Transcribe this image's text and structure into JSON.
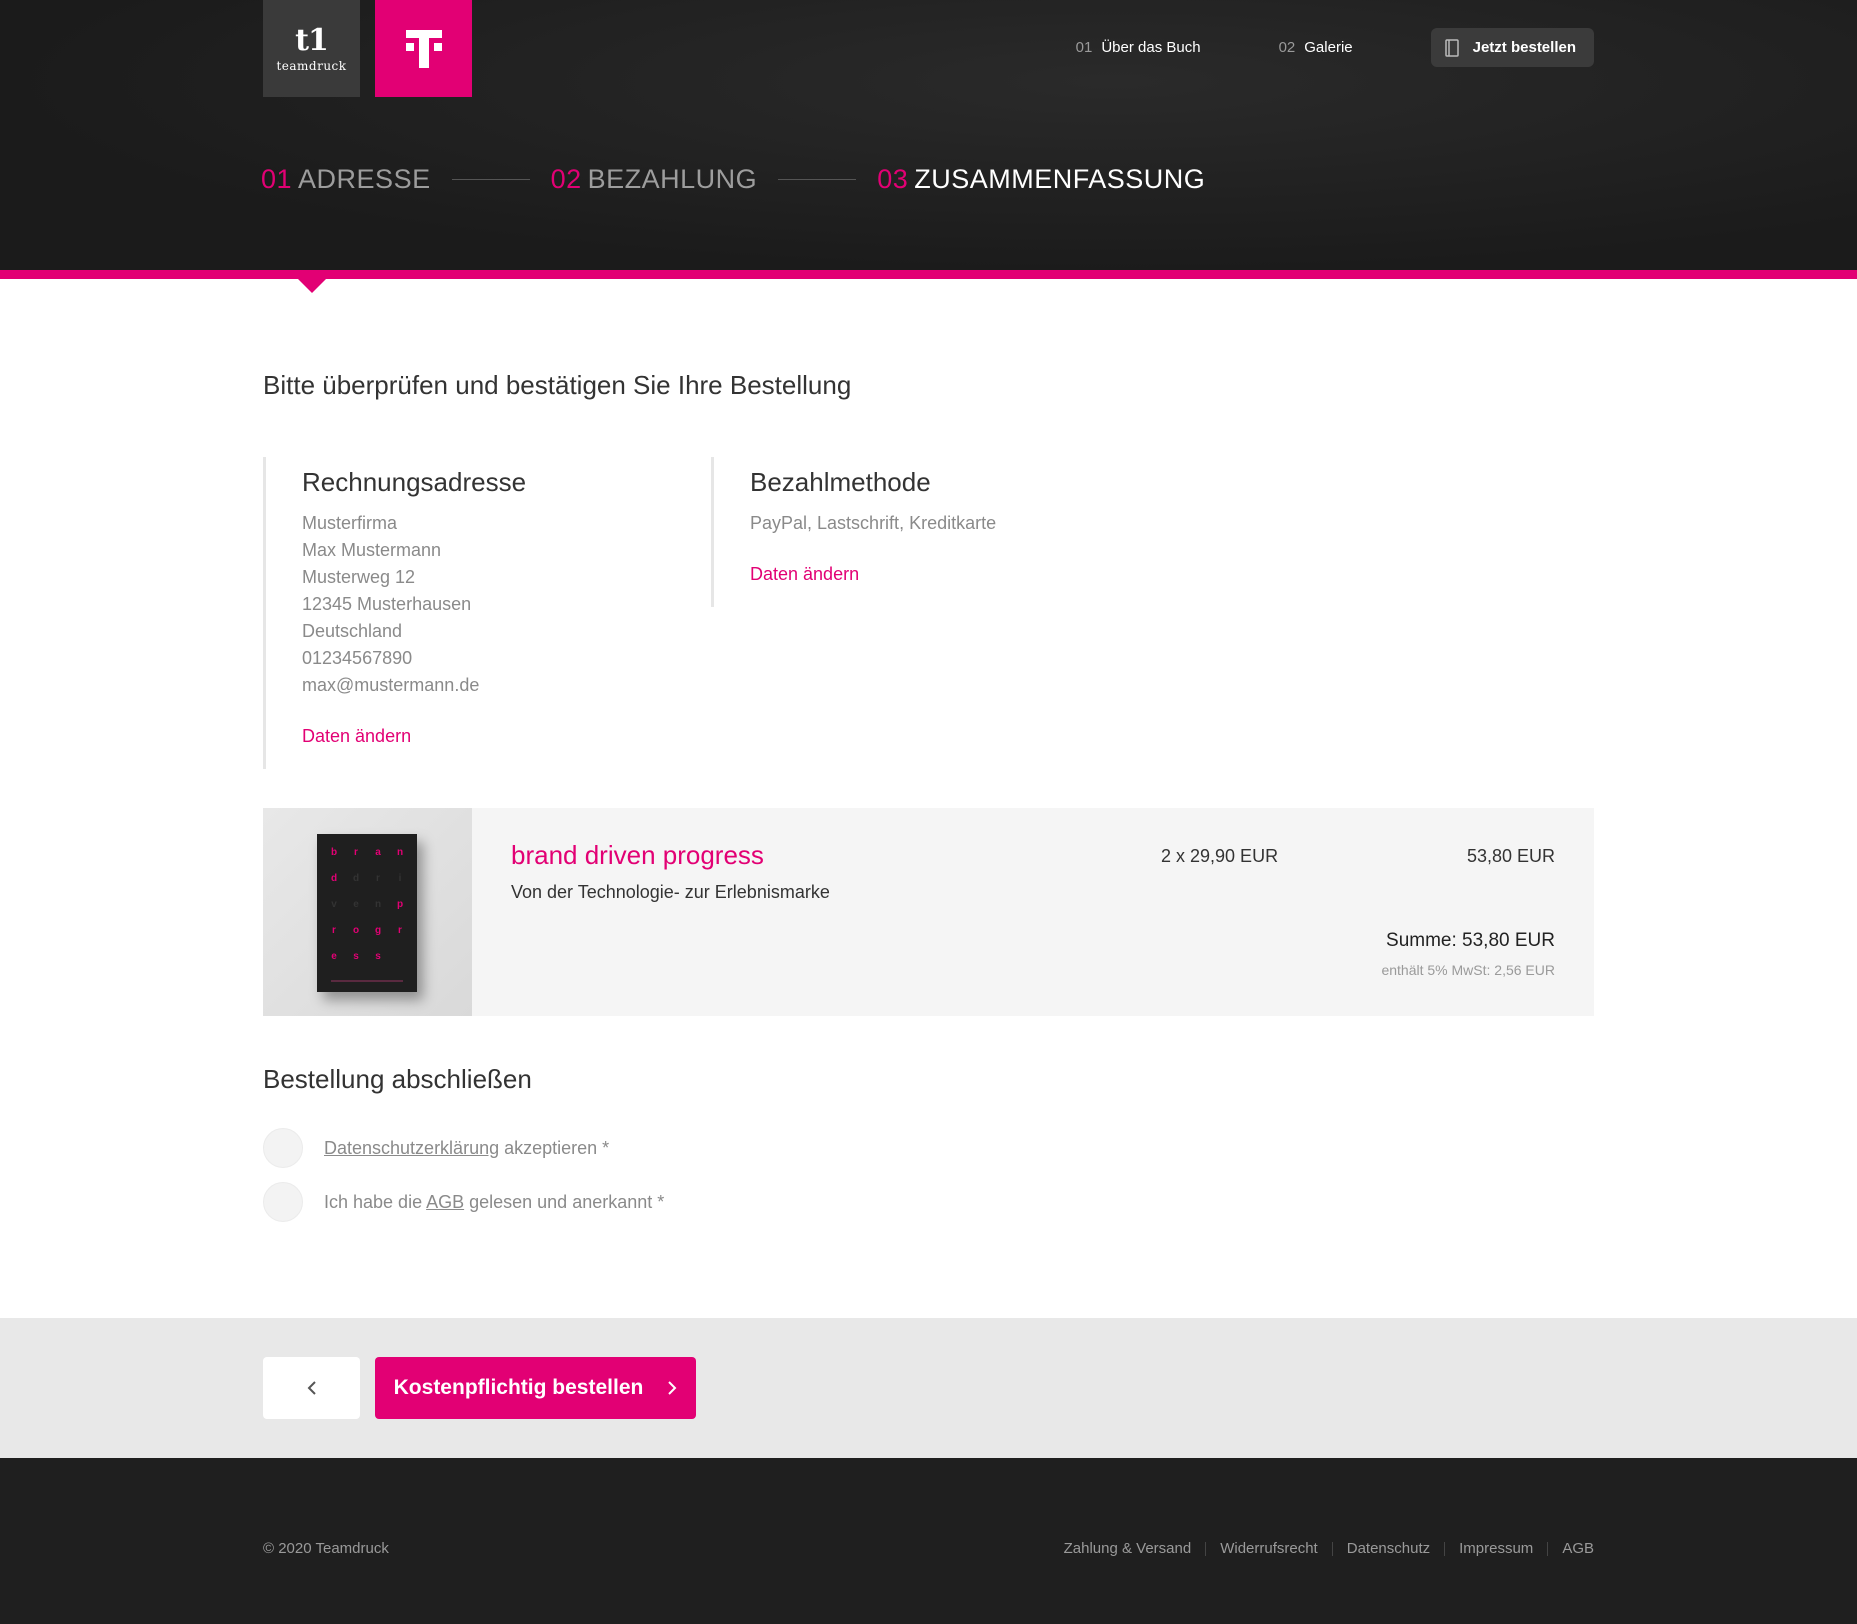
{
  "brand": {
    "teamdruck_mark": "t1",
    "teamdruck_word": "teamdruck",
    "accent_color": "#e20074"
  },
  "nav": {
    "items": [
      {
        "num": "01",
        "label": "Über das Buch"
      },
      {
        "num": "02",
        "label": "Galerie"
      }
    ],
    "order_button": "Jetzt bestellen"
  },
  "steps": [
    {
      "num": "01",
      "label": "ADRESSE"
    },
    {
      "num": "02",
      "label": "BEZAHLUNG"
    },
    {
      "num": "03",
      "label": "ZUSAMMENFASSUNG"
    }
  ],
  "main": {
    "title": "Bitte überprüfen und bestätigen Sie Ihre Bestellung",
    "billing": {
      "heading": "Rechnungsadresse",
      "lines": [
        "Musterfirma",
        "Max Mustermann",
        "Musterweg 12",
        "12345 Musterhausen",
        "Deutschland",
        "01234567890",
        "max@mustermann.de"
      ],
      "edit": "Daten ändern"
    },
    "payment": {
      "heading": "Bezahlmethode",
      "methods": "PayPal, Lastschrift, Kreditkarte",
      "edit": "Daten ändern"
    },
    "product": {
      "title": "brand driven progress",
      "subtitle": "Von der Technologie- zur Erlebnismarke",
      "quantity_price": "2 x 29,90 EUR",
      "line_total": "53,80 EUR",
      "sum": "Summe: 53,80 EUR",
      "vat": "enthält 5% MwSt: 2,56 EUR",
      "cover_letters": [
        "b",
        "r",
        "a",
        "n",
        "d",
        "d",
        "r",
        "i",
        "v",
        "e",
        "n",
        "p",
        "r",
        "o",
        "g",
        "r",
        "e",
        "s",
        "s",
        ""
      ]
    },
    "complete": {
      "heading": "Bestellung abschließen",
      "privacy_link": "Datenschutzerklärung",
      "privacy_suffix": " akzeptieren *",
      "terms_prefix": "Ich habe die ",
      "terms_link": "AGB",
      "terms_suffix": " gelesen und anerkannt *"
    }
  },
  "actions": {
    "submit": "Kostenpflichtig bestellen"
  },
  "footer": {
    "copyright": "© 2020 Teamdruck",
    "links": [
      "Zahlung & Versand",
      "Widerrufsrecht",
      "Datenschutz",
      "Impressum",
      "AGB"
    ]
  }
}
